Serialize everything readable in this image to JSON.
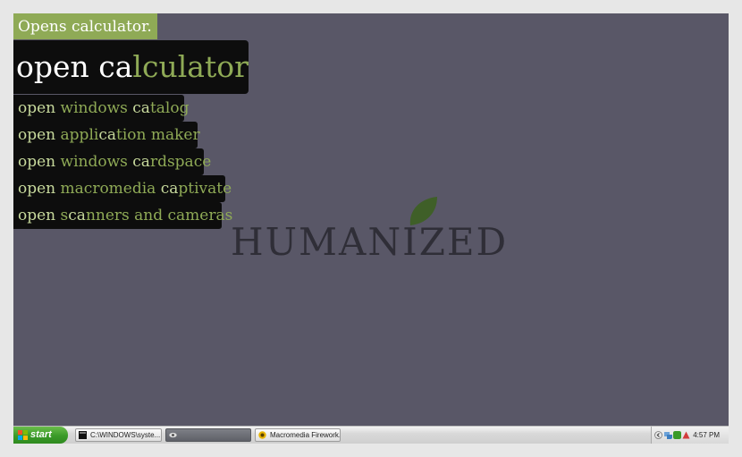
{
  "overlay": {
    "description": "Opens calculator.",
    "main_command": {
      "typed": "open ca",
      "rest": "lculator"
    },
    "suggestions": [
      {
        "parts": [
          "open",
          " windows ",
          "ca",
          "talog"
        ]
      },
      {
        "parts": [
          "open",
          " appli",
          "ca",
          "tion maker"
        ]
      },
      {
        "parts": [
          "open",
          " windows ",
          "ca",
          "rdspace"
        ]
      },
      {
        "parts": [
          "open",
          " macromedia ",
          "ca",
          "ptivate"
        ]
      },
      {
        "parts": [
          "open",
          " s",
          "ca",
          "nners and cameras"
        ]
      }
    ]
  },
  "desktop": {
    "logo_text": "HUMANIZED"
  },
  "taskbar": {
    "start_label": "start",
    "tasks": [
      {
        "label": "C:\\WINDOWS\\syste...",
        "icon": "console-icon"
      },
      {
        "label": "",
        "icon": "eye-icon"
      },
      {
        "label": "Macromedia Firework...",
        "icon": "fireworks-icon"
      }
    ],
    "clock": "4:57 PM"
  },
  "colors": {
    "desktop_bg": "#595767",
    "accent_green": "#8faa56",
    "overlay_bg": "#0d0d0d"
  }
}
